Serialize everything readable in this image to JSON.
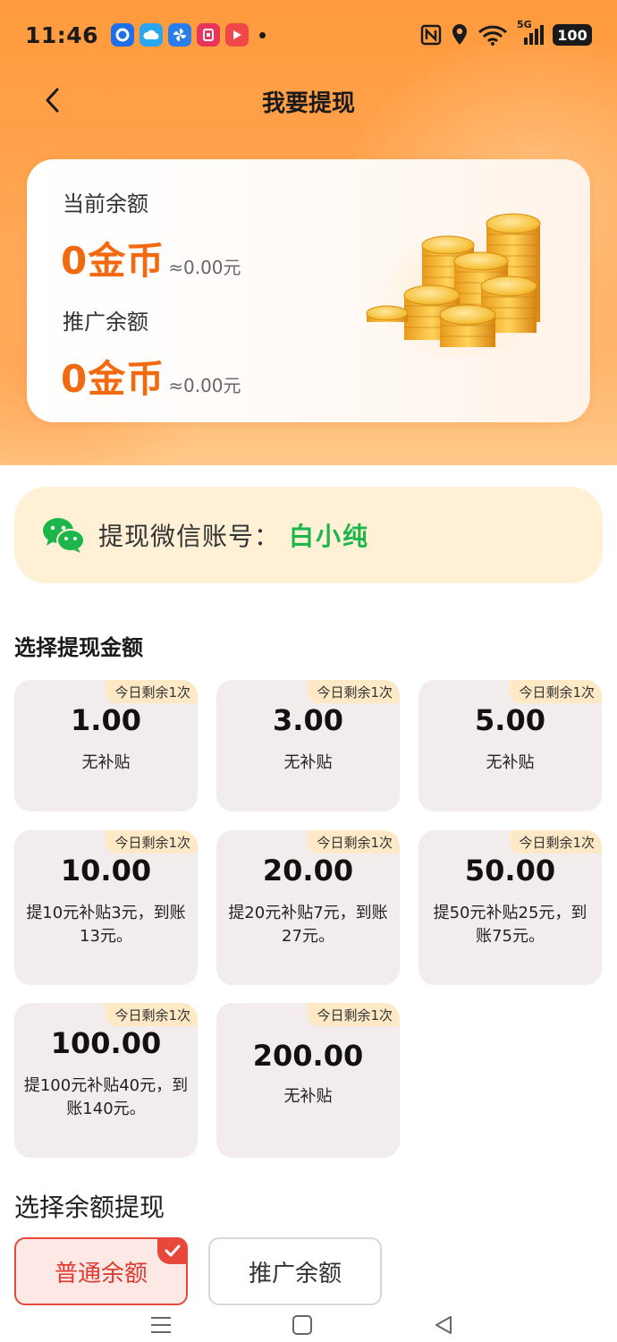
{
  "status_bar": {
    "time": "11:46",
    "network": "5G",
    "battery": "100",
    "apps": [
      {
        "icon": "app-blue-circle-icon",
        "color": "#1e6fe8"
      },
      {
        "icon": "app-cloud-icon",
        "color": "#2aa6f0"
      },
      {
        "icon": "app-pinwheel-icon",
        "color": "#2b7de9"
      },
      {
        "icon": "app-red-store-icon",
        "color": "#e8365a"
      },
      {
        "icon": "app-video-play-icon",
        "color": "#f04848"
      }
    ]
  },
  "nav": {
    "title": "我要提现",
    "back_icon": "chevron-left-icon"
  },
  "balance_card": {
    "current_label": "当前余额",
    "current_coins": "0金币",
    "current_yuan": "≈0.00元",
    "promo_label": "推广余额",
    "promo_coins": "0金币",
    "promo_yuan": "≈0.00元",
    "coin_color": "#f26a0f"
  },
  "wechat": {
    "label": "提现微信账号：",
    "name": "白小纯",
    "name_color": "#1db64a"
  },
  "amount_section": {
    "title": "选择提现金额",
    "options": [
      {
        "badge": "今日剩余1次",
        "amount": "1.00",
        "desc": "无补贴"
      },
      {
        "badge": "今日剩余1次",
        "amount": "3.00",
        "desc": "无补贴"
      },
      {
        "badge": "今日剩余1次",
        "amount": "5.00",
        "desc": "无补贴"
      },
      {
        "badge": "今日剩余1次",
        "amount": "10.00",
        "desc": "提10元补贴3元，到账13元。"
      },
      {
        "badge": "今日剩余1次",
        "amount": "20.00",
        "desc": "提20元补贴7元，到账27元。"
      },
      {
        "badge": "今日剩余1次",
        "amount": "50.00",
        "desc": "提50元补贴25元，到账75元。"
      },
      {
        "badge": "今日剩余1次",
        "amount": "100.00",
        "desc": "提100元补贴40元，到账140元。"
      },
      {
        "badge": "今日剩余1次",
        "amount": "200.00",
        "desc": "无补贴"
      }
    ]
  },
  "balance_type": {
    "title": "选择余额提现",
    "normal_label": "普通余额",
    "promo_label": "推广余额",
    "selected": "普通余额",
    "accent": "#e8473c"
  },
  "system_nav": {
    "menu_icon": "menu-lines-icon",
    "home_icon": "home-square-icon",
    "back_icon": "back-triangle-icon"
  }
}
